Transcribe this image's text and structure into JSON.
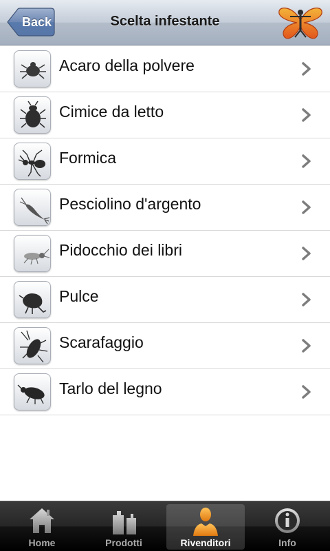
{
  "navbar": {
    "back_label": "Back",
    "title": "Scelta infestante",
    "logo_icon": "butterfly-logo-icon"
  },
  "list": {
    "items": [
      {
        "label": "Acaro della polvere",
        "icon": "dust-mite-icon"
      },
      {
        "label": "Cimice da letto",
        "icon": "bedbug-icon"
      },
      {
        "label": "Formica",
        "icon": "ant-icon"
      },
      {
        "label": "Pesciolino d'argento",
        "icon": "silverfish-icon"
      },
      {
        "label": "Pidocchio dei libri",
        "icon": "booklouse-icon"
      },
      {
        "label": "Pulce",
        "icon": "flea-icon"
      },
      {
        "label": "Scarafaggio",
        "icon": "cockroach-icon"
      },
      {
        "label": "Tarlo del legno",
        "icon": "woodworm-icon"
      }
    ]
  },
  "tabbar": {
    "active": "Rivenditori",
    "tabs": [
      {
        "label": "Home",
        "icon": "home-icon"
      },
      {
        "label": "Prodotti",
        "icon": "products-icon"
      },
      {
        "label": "Rivenditori",
        "icon": "dealer-person-icon"
      },
      {
        "label": "Info",
        "icon": "info-icon"
      }
    ]
  },
  "colors": {
    "accent_active_icon": "#f29a1f",
    "navbar_top": "#e6ebf1",
    "navbar_bottom": "#a4afbf",
    "back_button": "#6e88b4"
  }
}
